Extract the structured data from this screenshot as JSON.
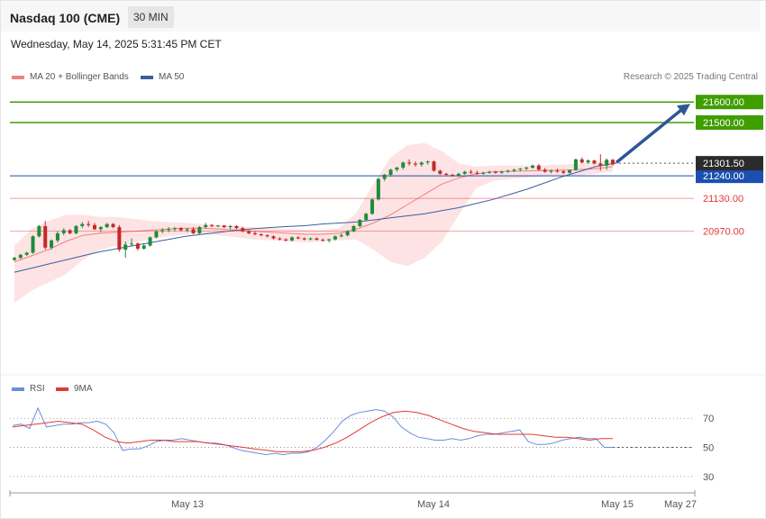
{
  "header": {
    "title": "Nasdaq 100 (CME)",
    "timeframe": "30 MIN"
  },
  "datetime": "Wednesday, May 14, 2025 5:31:45 PM CET",
  "legend": {
    "ma20": "MA 20 + Bollinger Bands",
    "ma50": "MA 50",
    "rsi": "RSI",
    "rsi9": "9MA"
  },
  "credit": "Research © 2025 Trading Central",
  "colors": {
    "up": "#1e8c3a",
    "down": "#c62828",
    "ma50": "#3a5f9e",
    "ma20": "#f08080",
    "band": "#fde3e3",
    "target": "#3f9e00",
    "support_red": "#e53935",
    "pivot": "#1c4fb0",
    "rsi": "#6b8ed6",
    "rsi9": "#e53935"
  },
  "chart_data": [
    {
      "type": "candlestick",
      "title": "Nasdaq 100 (CME)",
      "interval": "30 MIN",
      "x_ticks": [
        "May 13",
        "May 14",
        "May 15",
        "May 27"
      ],
      "ylim": [
        20340,
        21680
      ],
      "last_price": 21301.5,
      "levels": [
        {
          "value": 21600.0,
          "label": "21600.00",
          "kind": "target"
        },
        {
          "value": 21500.0,
          "label": "21500.00",
          "kind": "target"
        },
        {
          "value": 21240.0,
          "label": "21240.00",
          "kind": "pivot"
        },
        {
          "value": 21130.0,
          "label": "21130.00",
          "kind": "support"
        },
        {
          "value": 20970.0,
          "label": "20970.00",
          "kind": "support"
        }
      ],
      "last_price_label": "21301.50",
      "candles": [
        [
          20830,
          20845,
          20825,
          20840
        ],
        [
          20840,
          20860,
          20835,
          20855
        ],
        [
          20855,
          20870,
          20850,
          20865
        ],
        [
          20865,
          20950,
          20860,
          20945
        ],
        [
          20945,
          21000,
          20940,
          20995
        ],
        [
          20995,
          21020,
          20880,
          20890
        ],
        [
          20890,
          20930,
          20880,
          20925
        ],
        [
          20925,
          20970,
          20915,
          20960
        ],
        [
          20960,
          20985,
          20950,
          20975
        ],
        [
          20975,
          20980,
          20955,
          20960
        ],
        [
          20960,
          21000,
          20955,
          20995
        ],
        [
          20995,
          21015,
          20985,
          21005
        ],
        [
          21005,
          21020,
          20990,
          21000
        ],
        [
          21000,
          21010,
          20975,
          20980
        ],
        [
          20980,
          20995,
          20965,
          20990
        ],
        [
          20990,
          21010,
          20985,
          21005
        ],
        [
          21005,
          21010,
          20985,
          20990
        ],
        [
          20990,
          21000,
          20870,
          20880
        ],
        [
          20880,
          20920,
          20840,
          20905
        ],
        [
          20905,
          20935,
          20900,
          20910
        ],
        [
          20910,
          20915,
          20875,
          20885
        ],
        [
          20885,
          20910,
          20880,
          20900
        ],
        [
          20900,
          20945,
          20895,
          20940
        ],
        [
          20940,
          20975,
          20935,
          20970
        ],
        [
          20970,
          20985,
          20960,
          20975
        ],
        [
          20975,
          20990,
          20965,
          20980
        ],
        [
          20980,
          20990,
          20970,
          20985
        ],
        [
          20985,
          20990,
          20970,
          20975
        ],
        [
          20975,
          20985,
          20965,
          20980
        ],
        [
          20980,
          20990,
          20955,
          20960
        ],
        [
          20960,
          20995,
          20955,
          20990
        ],
        [
          20990,
          21010,
          20985,
          21000
        ],
        [
          21000,
          21005,
          20990,
          20995
        ],
        [
          20995,
          21000,
          20990,
          20998
        ],
        [
          20998,
          21000,
          20985,
          20990
        ],
        [
          20990,
          21000,
          20980,
          20995
        ],
        [
          20995,
          21000,
          20980,
          20985
        ],
        [
          20985,
          20990,
          20965,
          20970
        ],
        [
          20970,
          20975,
          20955,
          20960
        ],
        [
          20960,
          20970,
          20950,
          20955
        ],
        [
          20955,
          20960,
          20945,
          20950
        ],
        [
          20950,
          20955,
          20940,
          20945
        ],
        [
          20945,
          20950,
          20930,
          20935
        ],
        [
          20935,
          20940,
          20925,
          20930
        ],
        [
          20930,
          20935,
          20920,
          20925
        ],
        [
          20925,
          20945,
          20920,
          20940
        ],
        [
          20940,
          20945,
          20930,
          20935
        ],
        [
          20935,
          20940,
          20925,
          20930
        ],
        [
          20930,
          20940,
          20925,
          20935
        ],
        [
          20935,
          20940,
          20925,
          20928
        ],
        [
          20928,
          20935,
          20920,
          20925
        ],
        [
          20925,
          20935,
          20915,
          20930
        ],
        [
          20930,
          20950,
          20925,
          20945
        ],
        [
          20945,
          20960,
          20940,
          20950
        ],
        [
          20950,
          20975,
          20945,
          20970
        ],
        [
          20970,
          21000,
          20965,
          20995
        ],
        [
          20995,
          21030,
          20990,
          21025
        ],
        [
          21025,
          21060,
          21020,
          21055
        ],
        [
          21055,
          21130,
          21050,
          21125
        ],
        [
          21125,
          21230,
          21120,
          21225
        ],
        [
          21225,
          21250,
          21215,
          21245
        ],
        [
          21245,
          21275,
          21235,
          21270
        ],
        [
          21270,
          21285,
          21260,
          21280
        ],
        [
          21280,
          21310,
          21270,
          21305
        ],
        [
          21305,
          21320,
          21290,
          21300
        ],
        [
          21300,
          21310,
          21285,
          21295
        ],
        [
          21295,
          21310,
          21285,
          21305
        ],
        [
          21305,
          21315,
          21295,
          21310
        ],
        [
          21310,
          21315,
          21260,
          21265
        ],
        [
          21265,
          21270,
          21245,
          21250
        ],
        [
          21250,
          21255,
          21240,
          21245
        ],
        [
          21245,
          21250,
          21235,
          21240
        ],
        [
          21240,
          21255,
          21235,
          21250
        ],
        [
          21250,
          21265,
          21245,
          21260
        ],
        [
          21260,
          21270,
          21250,
          21255
        ],
        [
          21255,
          21265,
          21245,
          21250
        ],
        [
          21250,
          21260,
          21245,
          21255
        ],
        [
          21255,
          21265,
          21250,
          21260
        ],
        [
          21260,
          21265,
          21250,
          21255
        ],
        [
          21255,
          21265,
          21250,
          21260
        ],
        [
          21260,
          21270,
          21255,
          21265
        ],
        [
          21265,
          21275,
          21258,
          21270
        ],
        [
          21270,
          21278,
          21262,
          21275
        ],
        [
          21275,
          21285,
          21268,
          21280
        ],
        [
          21280,
          21295,
          21275,
          21290
        ],
        [
          21290,
          21298,
          21265,
          21270
        ],
        [
          21270,
          21278,
          21255,
          21260
        ],
        [
          21260,
          21270,
          21252,
          21265
        ],
        [
          21265,
          21275,
          21255,
          21262
        ],
        [
          21262,
          21268,
          21248,
          21255
        ],
        [
          21255,
          21270,
          21250,
          21268
        ],
        [
          21268,
          21325,
          21265,
          21320
        ],
        [
          21320,
          21330,
          21300,
          21305
        ],
        [
          21305,
          21320,
          21298,
          21315
        ],
        [
          21315,
          21318,
          21296,
          21300
        ],
        [
          21300,
          21345,
          21265,
          21290
        ],
        [
          21290,
          21325,
          21270,
          21318
        ],
        [
          21318,
          21322,
          21290,
          21296
        ]
      ],
      "ma50": [
        20770,
        20790,
        20810,
        20830,
        20850,
        20870,
        20885,
        20900,
        20915,
        20930,
        20945,
        20955,
        20965,
        20975,
        20982,
        20988,
        20993,
        20997,
        21005,
        21010,
        21015,
        21025,
        21035,
        21045,
        21055,
        21070,
        21085,
        21105,
        21125,
        21150,
        21175,
        21205,
        21235,
        21260,
        21285,
        21300
      ],
      "ma20": [
        20820,
        20850,
        20880,
        20920,
        20950,
        20960,
        20965,
        20970,
        20975,
        20980,
        20985,
        20985,
        20980,
        20975,
        20970,
        20965,
        20960,
        20955,
        20955,
        20960,
        20980,
        21010,
        21050,
        21100,
        21150,
        21200,
        21230,
        21250,
        21260,
        21262,
        21264,
        21266,
        21268,
        21270,
        21275,
        21285
      ],
      "bb_upper": [
        20900,
        20980,
        21020,
        21050,
        21050,
        21040,
        21040,
        21030,
        21020,
        21015,
        21010,
        21005,
        21000,
        20995,
        20990,
        20985,
        20980,
        20978,
        20975,
        20985,
        21060,
        21200,
        21330,
        21390,
        21400,
        21360,
        21300,
        21285,
        21290,
        21290,
        21290,
        21292,
        21295,
        21300,
        21305,
        21320
      ],
      "bb_lower": [
        20620,
        20680,
        20720,
        20760,
        20830,
        20880,
        20900,
        20915,
        20930,
        20945,
        20955,
        20958,
        20950,
        20940,
        20930,
        20925,
        20920,
        20915,
        20920,
        20925,
        20930,
        20880,
        20820,
        20800,
        20840,
        20920,
        21050,
        21180,
        21215,
        21225,
        21232,
        21238,
        21240,
        21242,
        21250,
        21260
      ]
    },
    {
      "type": "line",
      "title": "RSI",
      "ylim": [
        20,
        85
      ],
      "y_ticks": [
        70,
        50,
        30
      ],
      "series": [
        {
          "name": "RSI",
          "values": [
            65,
            66,
            63,
            77,
            64,
            65,
            66,
            66,
            67,
            67,
            68,
            66,
            60,
            48,
            49,
            49,
            51,
            54,
            55,
            55,
            56,
            55,
            54,
            53,
            53,
            52,
            50,
            48,
            47,
            46,
            45,
            46,
            45,
            46,
            46,
            47,
            50,
            55,
            61,
            68,
            72,
            74,
            75,
            76,
            75,
            71,
            64,
            60,
            57,
            56,
            55,
            55,
            56,
            55,
            56,
            58,
            59,
            59,
            60,
            61,
            62,
            54,
            52,
            52,
            53,
            55,
            56,
            57,
            56,
            56,
            50,
            50
          ]
        },
        {
          "name": "9MA",
          "values": [
            64,
            65,
            66,
            67,
            68,
            67,
            66,
            62,
            57,
            54,
            53,
            54,
            55,
            55,
            54,
            54,
            54,
            53,
            52,
            51,
            50,
            49,
            48,
            47,
            47,
            47,
            48,
            50,
            53,
            57,
            62,
            67,
            71,
            74,
            75,
            74,
            72,
            69,
            66,
            63,
            61,
            60,
            59,
            59,
            59,
            59,
            58,
            57,
            57,
            56,
            55,
            56,
            56
          ]
        }
      ]
    }
  ]
}
